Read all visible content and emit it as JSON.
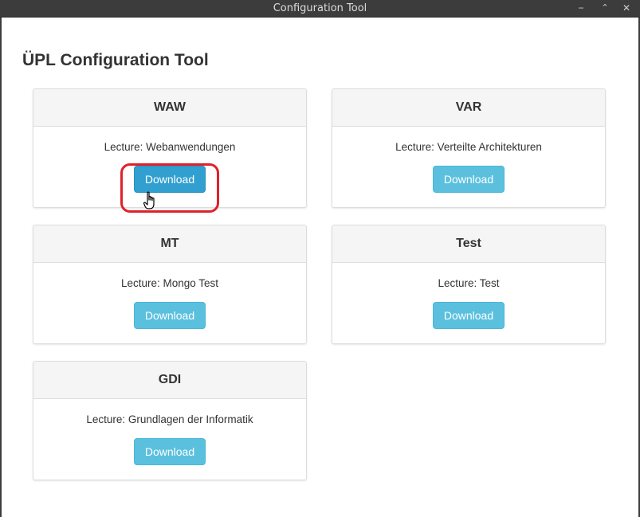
{
  "window": {
    "title": "Configuration Tool",
    "controls": {
      "minimize": "−",
      "maximize": "⌃",
      "close": "✕"
    }
  },
  "page": {
    "title": "ÜPL Configuration Tool"
  },
  "cards": [
    {
      "name": "WAW",
      "lecture": "Lecture: Webanwendungen",
      "button": "Download"
    },
    {
      "name": "VAR",
      "lecture": "Lecture: Verteilte Architekturen",
      "button": "Download"
    },
    {
      "name": "MT",
      "lecture": "Lecture: Mongo Test",
      "button": "Download"
    },
    {
      "name": "Test",
      "lecture": "Lecture: Test",
      "button": "Download"
    },
    {
      "name": "GDI",
      "lecture": "Lecture: Grundlagen der Informatik",
      "button": "Download"
    }
  ],
  "colors": {
    "button": "#5bc0de",
    "button_active": "#31a0d0",
    "highlight": "#e0202a",
    "titlebar": "#3c3c3c"
  },
  "icons": {
    "cursor": "hand-pointer-icon"
  }
}
